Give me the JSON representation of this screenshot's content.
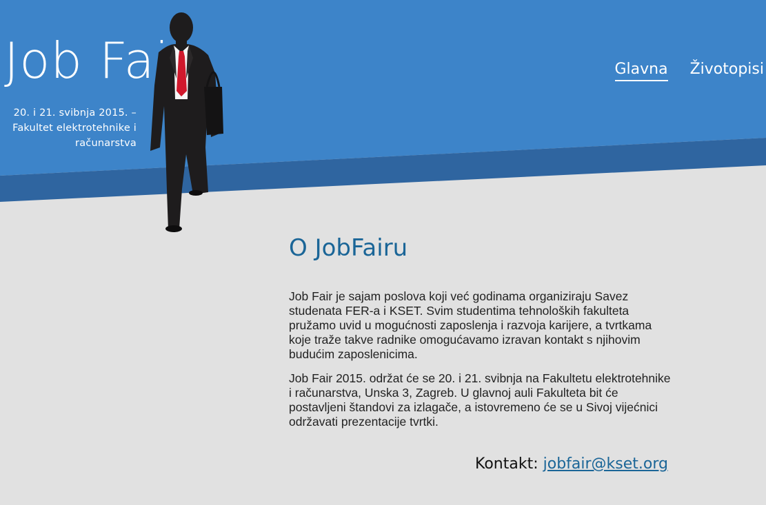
{
  "header": {
    "logo_title": "Job Fair",
    "logo_subtitle_line1": "20. i 21. svibnja 2015. –",
    "logo_subtitle_line2": "Fakultet elektrotehnike i",
    "logo_subtitle_line3": "računarstva"
  },
  "nav": {
    "items": [
      {
        "label": "Glavna",
        "active": true
      },
      {
        "label": "Životopisi",
        "active": false
      }
    ]
  },
  "main": {
    "title": "O JobFairu",
    "paragraphs": [
      "Job Fair je sajam poslova koji već godinama organiziraju Savez studenata FER-a i KSET. Svim studentima tehnoloških fakulteta pružamo uvid u mogućnosti zaposlenja i razvoja karijere, a tvrtkama koje traže takve radnike omogućavamo izravan kontakt s njihovim budućim zaposlenicima.",
      "Job Fair 2015. održat će se 20. i 21. svibnja na Fakultetu elektrotehnike i računarstva, Unska 3, Zagreb. U glavnoj auli Fakulteta bit će postavljeni štandovi za izlagače, a istovremeno će se u Sivoj vijećnici održavati prezentacije tvrtki."
    ],
    "contact_label": "Kontakt:",
    "contact_email": "jobfair@kset.org"
  },
  "colors": {
    "banner_blue": "#3d84c9",
    "banner_stripe": "#2f65a0",
    "background": "#e1e1e1",
    "heading_blue": "#1a6597",
    "tie_red": "#d0182c"
  },
  "icons": {
    "person": "businessman-silhouette"
  }
}
